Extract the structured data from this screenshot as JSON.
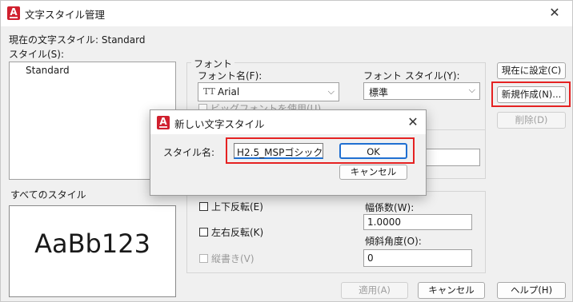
{
  "window": {
    "title": "文字スタイル管理",
    "close_label": "✕"
  },
  "current_style": {
    "label": "現在の文字スタイル:",
    "value": "Standard"
  },
  "styles": {
    "label": "スタイル(S):",
    "items": [
      "Standard"
    ],
    "filter": "すべてのスタイル"
  },
  "preview": {
    "text": "AaBb123"
  },
  "font": {
    "group_label": "フォント",
    "name_label": "フォント名(F):",
    "name_value": "Arial",
    "style_label": "フォント スタイル(Y):",
    "style_value": "標準",
    "bigfont_label": "ビッグフォントを使用(U)"
  },
  "effects": {
    "upside_down": "上下反転(E)",
    "backwards": "左右反転(K)",
    "vertical": "縦書き(V)",
    "width_factor_label": "幅係数(W):",
    "width_factor_value": "1.0000",
    "oblique_label": "傾斜角度(O):",
    "oblique_value": "0"
  },
  "buttons": {
    "set_current": "現在に設定(C)",
    "new": "新規作成(N)...",
    "delete": "削除(D)",
    "apply": "適用(A)",
    "cancel": "キャンセル",
    "help": "ヘルプ(H)"
  },
  "new_dialog": {
    "title": "新しい文字スタイル",
    "name_label": "スタイル名:",
    "name_value": "H2.5_MSPゴシック",
    "ok": "OK",
    "cancel": "キャンセル",
    "close_label": "✕"
  },
  "colors": {
    "highlight": "#e52222",
    "brand": "#d0202e",
    "focus": "#1f6fd1"
  }
}
